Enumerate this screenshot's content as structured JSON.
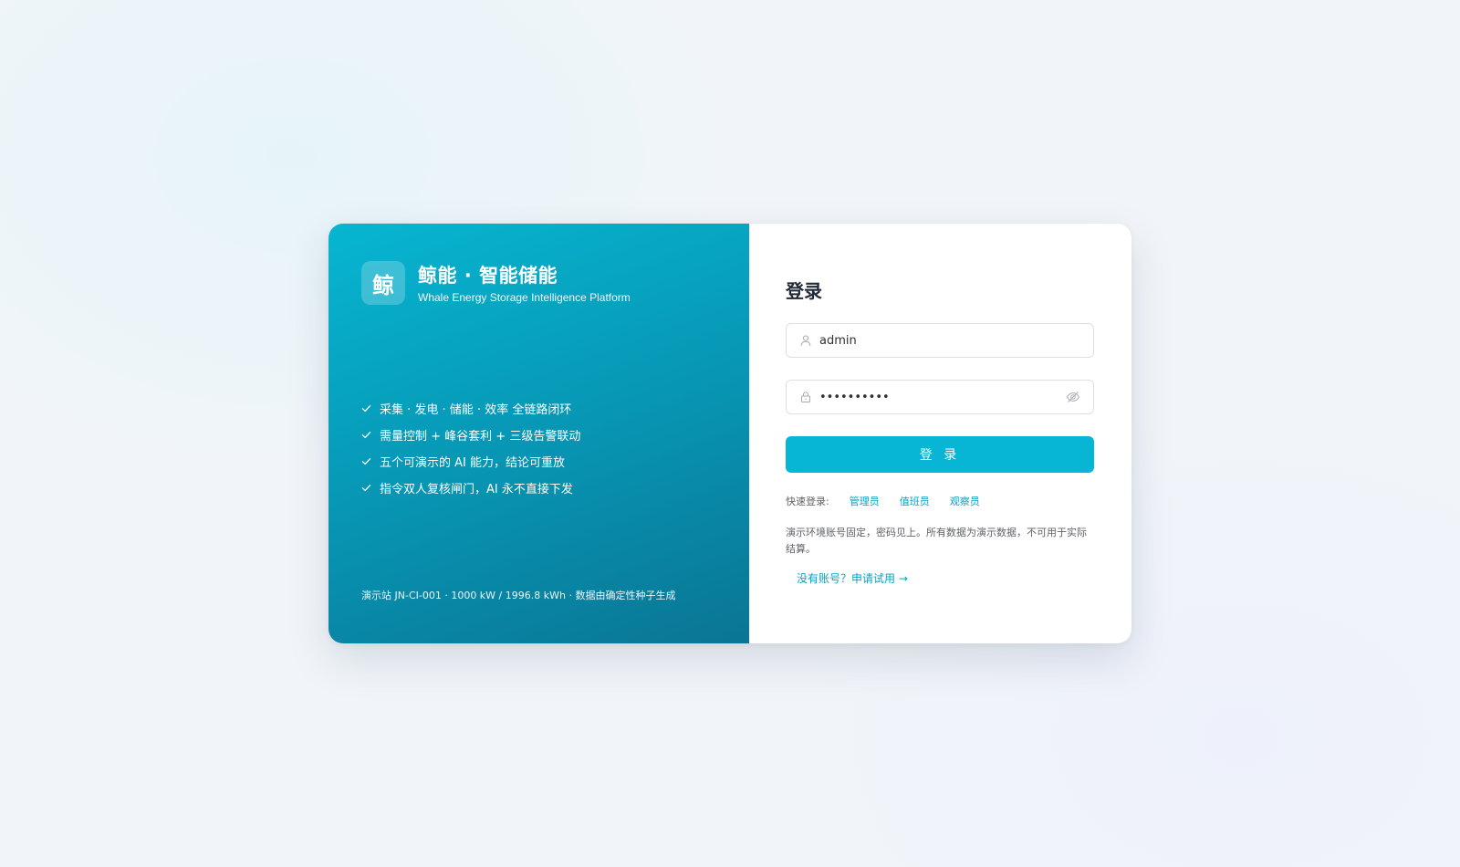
{
  "brand": {
    "logo_char": "鲸",
    "title": "鲸能 · 智能储能",
    "subtitle": "Whale Energy Storage Intelligence Platform"
  },
  "features": [
    "采集 · 发电 · 储能 · 效率 全链路闭环",
    "需量控制 + 峰谷套利 + 三级告警联动",
    "五个可演示的 AI 能力，结论可重放",
    "指令双人复核闸门，AI 永不直接下发"
  ],
  "footnote": "演示站 JN-CI-001 · 1000 kW / 1996.8 kWh · 数据由确定性种子生成",
  "login": {
    "title": "登录",
    "username_value": "admin",
    "password_value": "••••••••••",
    "submit_label": "登 录",
    "quick_label": "快速登录:",
    "quick_roles": [
      "管理员",
      "值班员",
      "观察员"
    ],
    "notice": "演示环境账号固定，密码见上。所有数据为演示数据，不可用于实际结算。",
    "apply_link": "没有账号？申请试用 →"
  },
  "colors": {
    "accent": "#06b6d4",
    "link": "#06a3c4",
    "panel_start": "#07b6d1",
    "panel_end": "#0a7594"
  },
  "icons": {
    "username": "user-icon",
    "password": "lock-icon",
    "reveal": "eye-off-icon",
    "feature": "check-icon"
  }
}
